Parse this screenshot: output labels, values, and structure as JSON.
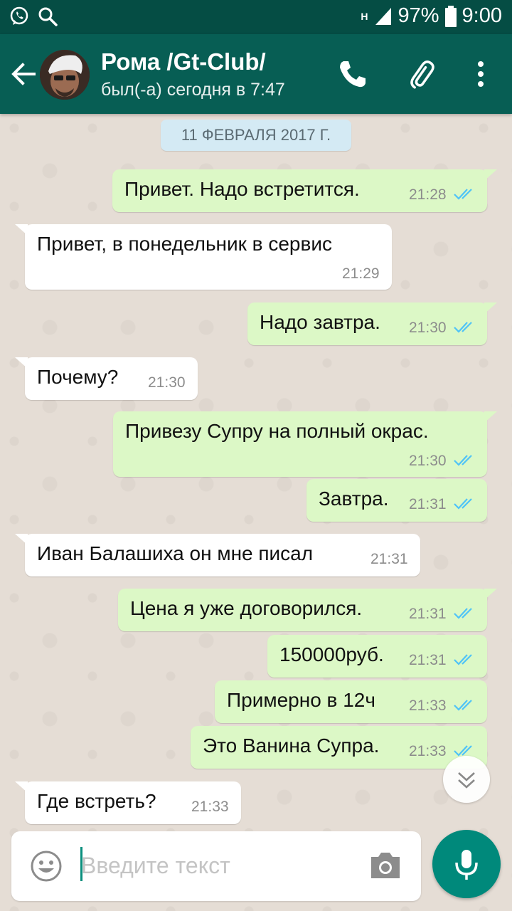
{
  "status_bar": {
    "battery": "97%",
    "time": "9:00",
    "network": "H"
  },
  "header": {
    "contact_name": "Рома /Gt-Club/",
    "status": "был(-а) сегодня в 7:47"
  },
  "chat": {
    "date": "11 ФЕВРАЛЯ 2017 Г.",
    "messages": [
      {
        "text": "Привет. Надо встретится.",
        "time": "21:28",
        "direction": "out"
      },
      {
        "text": "Привет, в понедельник в сервис",
        "time": "21:29",
        "direction": "in"
      },
      {
        "text": "Надо завтра.",
        "time": "21:30",
        "direction": "out"
      },
      {
        "text": "Почему?",
        "time": "21:30",
        "direction": "in"
      },
      {
        "text": "Привезу Супру на полный окрас.",
        "time": "21:30",
        "direction": "out"
      },
      {
        "text": "Завтра.",
        "time": "21:31",
        "direction": "out"
      },
      {
        "text": "Иван Балашиха он мне писал",
        "time": "21:31",
        "direction": "in"
      },
      {
        "text": "Цена я уже договорился.",
        "time": "21:31",
        "direction": "out"
      },
      {
        "text": "150000руб.",
        "time": "21:31",
        "direction": "out"
      },
      {
        "text": "Примерно в 12ч",
        "time": "21:33",
        "direction": "out"
      },
      {
        "text": "Это Ванина Супра.",
        "time": "21:33",
        "direction": "out"
      },
      {
        "text": "Где встреть?",
        "time": "21:33",
        "direction": "in"
      }
    ]
  },
  "composer": {
    "placeholder": "Введите текст",
    "value": ""
  },
  "colors": {
    "header": "#075e54",
    "status_bar": "#054d44",
    "outgoing": "#dcf8c6",
    "incoming": "#ffffff",
    "accent": "#00897b",
    "ticks": "#4fc3f7"
  },
  "icons": [
    "whatsapp-icon",
    "search-icon",
    "signal-icon",
    "battery-icon",
    "back-arrow-icon",
    "phone-icon",
    "paperclip-icon",
    "more-vert-icon",
    "double-tick-icon",
    "chevron-down-icon",
    "emoji-icon",
    "camera-icon",
    "mic-icon"
  ]
}
